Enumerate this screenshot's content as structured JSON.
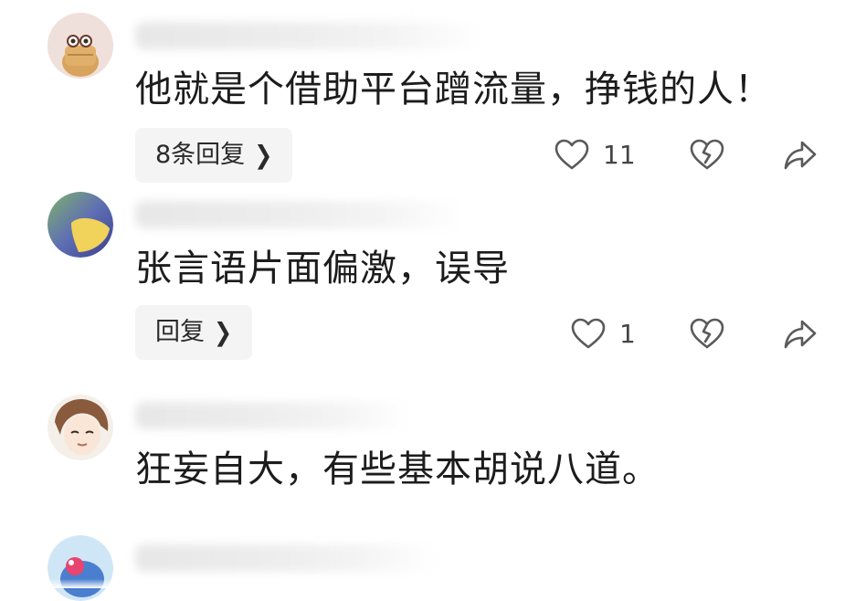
{
  "comments": [
    {
      "text": "他就是个借助平台蹭流量，挣钱的人！",
      "reply_label": "8条回复",
      "likes": "11"
    },
    {
      "text": "张言语片面偏激，误导",
      "reply_label": "回复",
      "likes": "1"
    },
    {
      "text": "狂妄自大，有些基本胡说八道。"
    }
  ],
  "icons": {
    "like": "heart-outline-icon",
    "dislike": "broken-heart-icon",
    "share": "share-arrow-icon",
    "chevron": "chevron-right-icon"
  },
  "colors": {
    "text": "#1c1c1c",
    "icon": "#5a5a5a",
    "reply_bg": "#f4f4f4"
  }
}
